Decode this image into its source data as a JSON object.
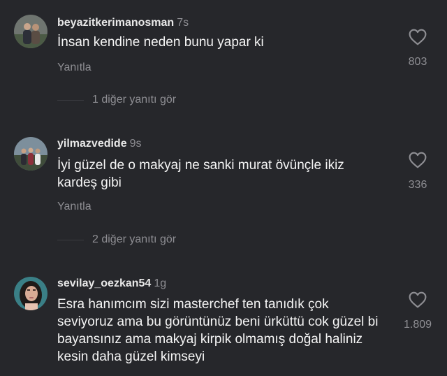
{
  "comments": [
    {
      "username": "beyazitkerimanosman",
      "time": "7s",
      "text": "İnsan kendine neden bunu yapar ki",
      "reply_label": "Yanıtla",
      "more_replies": "1 diğer yanıtı gör",
      "likes": "803",
      "icons": {
        "like": "heart-icon"
      }
    },
    {
      "username": "yilmazvedide",
      "time": "9s",
      "text": "İyi güzel de o makyaj ne sanki murat övünçle ikiz kardeş gibi",
      "reply_label": "Yanıtla",
      "more_replies": "2 diğer yanıtı gör",
      "likes": "336",
      "icons": {
        "like": "heart-icon"
      }
    },
    {
      "username": "sevilay_oezkan54",
      "time": "1g",
      "text": "Esra hanımcım sizi masterchef ten tanıdık çok seviyoruz ama bu görüntünüz beni ürküttü cok güzel bi bayansınız ama makyaj kirpik olmamış doğal haliniz kesin daha güzel kimseyi",
      "likes": "1.809",
      "icons": {
        "like": "heart-icon"
      }
    }
  ],
  "colors": {
    "background": "#26272b",
    "text": "#f5f5f5",
    "muted": "#8e8e93"
  }
}
